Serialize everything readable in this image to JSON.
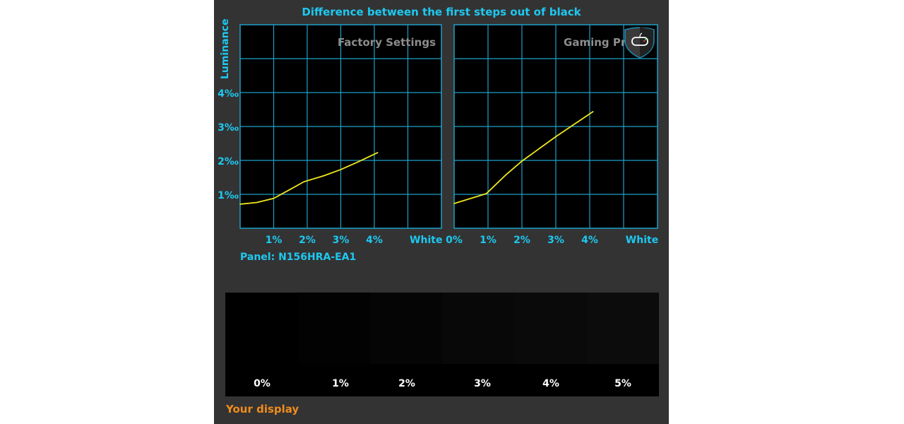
{
  "chart_data": [
    {
      "type": "line",
      "title": "Factory Settings",
      "ylabel": "Luminance",
      "x_tick_labels": [
        "1%",
        "2%",
        "3%",
        "4%",
        "White"
      ],
      "y_tick_labels": [
        "1‰",
        "2‰",
        "3‰",
        "4‰"
      ],
      "xlim": [
        0,
        6
      ],
      "ylim": [
        0,
        6
      ],
      "grid": true,
      "line_color": "#f0e61e",
      "grid_color": "#1ea0c8",
      "x": [
        0,
        0.5,
        1.0,
        1.5,
        1.9,
        2.5,
        3.0,
        3.5,
        4.1
      ],
      "y": [
        0.71,
        0.76,
        0.88,
        1.15,
        1.37,
        1.55,
        1.73,
        1.95,
        2.23
      ]
    },
    {
      "type": "line",
      "title": "Gaming Profile",
      "x_tick_labels": [
        "0%",
        "1%",
        "2%",
        "3%",
        "4%",
        "White"
      ],
      "xlim": [
        0,
        6
      ],
      "ylim": [
        0,
        6
      ],
      "grid": true,
      "line_color": "#f0e61e",
      "grid_color": "#1ea0c8",
      "x": [
        0,
        0.95,
        1.5,
        2.0,
        3.0,
        4.1
      ],
      "y": [
        0.73,
        1.02,
        1.55,
        1.98,
        2.7,
        3.44
      ]
    }
  ],
  "header": {
    "title": "Difference between the first steps out of black",
    "ylabel": "Luminance"
  },
  "panel_label": "Panel: N156HRA-EA1",
  "icon": "gamepad-shield-icon",
  "swatches": {
    "labels": [
      "0%",
      "1%",
      "2%",
      "3%",
      "4%",
      "5%"
    ],
    "colors": [
      "#000000",
      "#020202",
      "#050505",
      "#080808",
      "#0a0a0a",
      "#0c0c0c"
    ],
    "caption": "Your display"
  }
}
